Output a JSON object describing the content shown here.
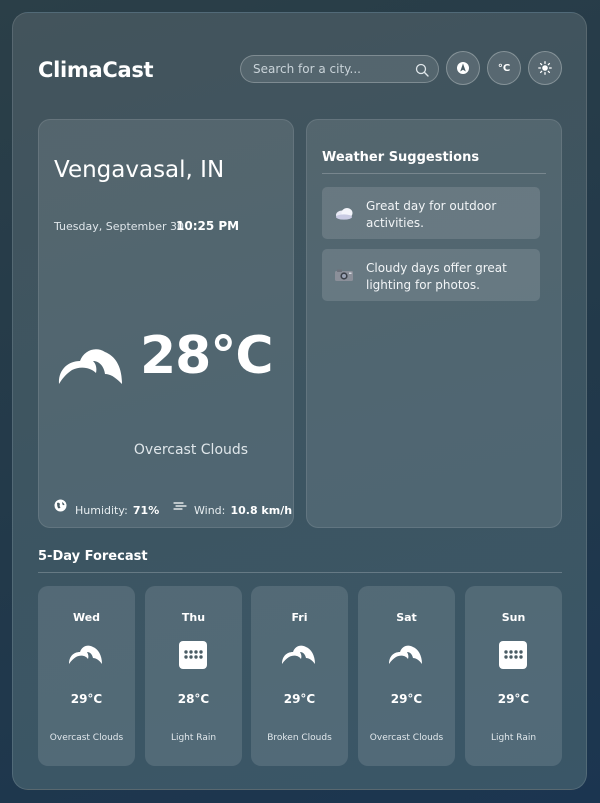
{
  "header": {
    "brand": "ClimaCast",
    "search_placeholder": "Search for a city...",
    "unit_toggle_label": "°C"
  },
  "current": {
    "city": "Vengavasal, IN",
    "date": "Tuesday, September 30",
    "time": "10:25 PM",
    "temperature": "28°C",
    "condition": "Overcast Clouds",
    "humidity_label": "Humidity:",
    "humidity_value": "71%",
    "wind_label": "Wind:",
    "wind_value": "10.8 km/h",
    "icon": "overcast-cloud-icon"
  },
  "suggestions": {
    "title": "Weather Suggestions",
    "items": [
      {
        "icon": "cloud-emoji-icon",
        "text": "Great day for outdoor activities."
      },
      {
        "icon": "camera-emoji-icon",
        "text": "Cloudy days offer great lighting for photos."
      }
    ]
  },
  "forecast": {
    "title": "5-Day Forecast",
    "days": [
      {
        "day": "Wed",
        "temp": "29°C",
        "desc": "Overcast Clouds",
        "icon": "overcast-cloud-icon"
      },
      {
        "day": "Thu",
        "temp": "28°C",
        "desc": "Light Rain",
        "icon": "rain-icon"
      },
      {
        "day": "Fri",
        "temp": "29°C",
        "desc": "Broken Clouds",
        "icon": "broken-cloud-icon"
      },
      {
        "day": "Sat",
        "temp": "29°C",
        "desc": "Overcast Clouds",
        "icon": "overcast-cloud-icon"
      },
      {
        "day": "Sun",
        "temp": "29°C",
        "desc": "Light Rain",
        "icon": "rain-icon"
      }
    ]
  },
  "colors": {
    "background": "#22394a",
    "panel": "#3d5561",
    "text": "#ffffff"
  }
}
